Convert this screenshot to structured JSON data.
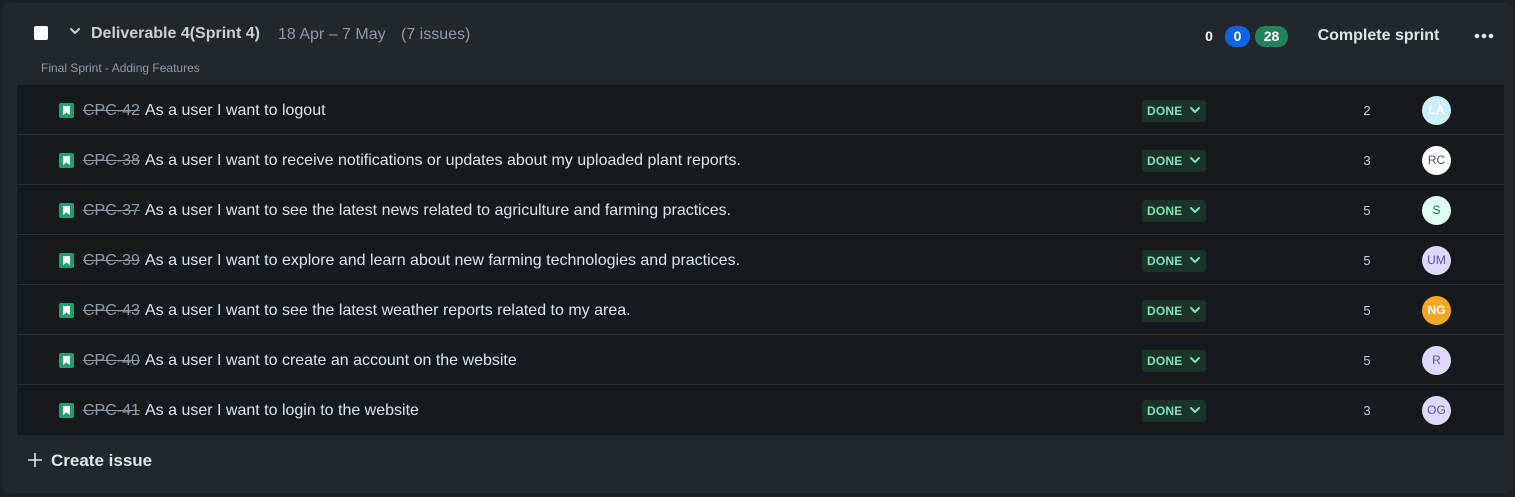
{
  "sprint": {
    "name": "Deliverable 4(Sprint 4)",
    "dates": "18 Apr – 7 May",
    "issue_count": "(7 issues)",
    "goal": "Final Sprint - Adding Features",
    "counts": {
      "todo": "0",
      "in_progress": "0",
      "done": "28"
    },
    "complete_label": "Complete sprint",
    "create_issue_label": "Create issue"
  },
  "issues": [
    {
      "key": "CPC-42",
      "summary": "As a user I want to logout",
      "status": "DONE",
      "points": "2",
      "assignee": "LA",
      "avatar_bg": "#cdeffc",
      "avatar_fg": "#ffffff"
    },
    {
      "key": "CPC-38",
      "summary": "As a user I want to receive notifications or updates about my uploaded plant reports.",
      "status": "DONE",
      "points": "3",
      "assignee": "RC",
      "avatar_bg": "#ffffff",
      "avatar_fg": "#44546f"
    },
    {
      "key": "CPC-37",
      "summary": "As a user I want to see the latest news related to agriculture and farming practices.",
      "status": "DONE",
      "points": "5",
      "assignee": "S",
      "avatar_bg": "#dcfff1",
      "avatar_fg": "#216e4e"
    },
    {
      "key": "CPC-39",
      "summary": "As a user I want to explore and learn about new farming technologies and practices.",
      "status": "DONE",
      "points": "5",
      "assignee": "UM",
      "avatar_bg": "#dfd8fd",
      "avatar_fg": "#5e4db2"
    },
    {
      "key": "CPC-43",
      "summary": "As a user I want to see the latest weather reports related to my area.",
      "status": "DONE",
      "points": "5",
      "assignee": "NG",
      "avatar_bg": "#f5a623",
      "avatar_fg": "#ffffff"
    },
    {
      "key": "CPC-40",
      "summary": "As a user I want to create an account on the website",
      "status": "DONE",
      "points": "5",
      "assignee": "R",
      "avatar_bg": "#dfd8fd",
      "avatar_fg": "#5e4db2"
    },
    {
      "key": "CPC-41",
      "summary": "As a user I want to login to the website",
      "status": "DONE",
      "points": "3",
      "assignee": "OG",
      "avatar_bg": "#dfd8fd",
      "avatar_fg": "#5e4db2"
    }
  ],
  "icons": {
    "issue_type": "story-icon",
    "status_dropdown": "chevron-down-icon",
    "collapse": "chevron-down-icon",
    "more": "more-icon",
    "create": "plus-icon"
  },
  "colors": {
    "story": "#22a06b",
    "done_lozenge_bg": "#1c3329",
    "done_lozenge_text": "#7ee2b8",
    "in_progress": "#0c66e4",
    "done_count": "#1f845a"
  }
}
